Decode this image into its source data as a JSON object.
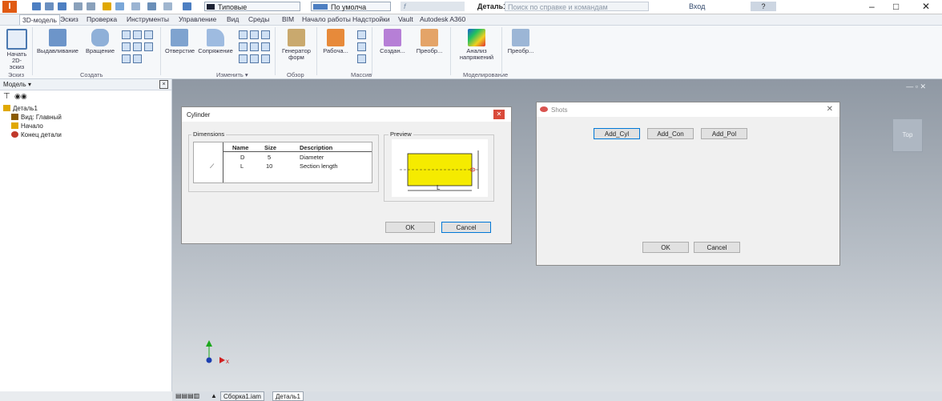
{
  "titlebar": {
    "logo": "I",
    "style_select": "Типовые",
    "material_select": "По умолча",
    "fx_label": "f",
    "doc_title": "Деталь1",
    "help_search_placeholder": "Поиск по справке и командам",
    "login": "Вход",
    "help": "?",
    "minimize": "–",
    "maximize": "□",
    "close": "✕"
  },
  "ribbon_tabs": [
    "3D-модель",
    "Эскиз",
    "Проверка",
    "Инструменты",
    "Управление",
    "Вид",
    "Среды",
    "BIM",
    "Начало работы",
    "Надстройки",
    "Vault",
    "Autodesk A360"
  ],
  "ribbon": {
    "groups": {
      "sketch": "Эскиз",
      "create": "Создать",
      "modify": "Изменить ▾",
      "explore": "Обзор",
      "pattern": "Массив",
      "simulation": "Моделирование"
    },
    "buttons": {
      "start_sketch": "Начать 2D-эскиз",
      "extrude": "Выдавливание",
      "revolve": "Вращение",
      "hole": "Отверстие",
      "fillet": "Сопряжение",
      "shape_generator": "Генератор форм",
      "work_features": "Рабоча...",
      "surface": "Создан...",
      "convert": "Преобр...",
      "stress": "Анализ напряжений",
      "convert2": "Преобр..."
    }
  },
  "browser": {
    "title": "Модель ▾",
    "items": [
      {
        "label": "Деталь1",
        "icon_color": "#e0a800"
      },
      {
        "label": "Вид: Главный",
        "icon_color": "#8a5a00"
      },
      {
        "label": "Начало",
        "icon_color": "#e0a800"
      },
      {
        "label": "Конец детали",
        "icon_color": "#c0392b"
      }
    ]
  },
  "cylinder_dialog": {
    "title": "Cylinder",
    "dimensions_label": "Dimensions",
    "headers": [
      "Name",
      "Size",
      "Description"
    ],
    "rows": [
      {
        "marker": "",
        "name": "D",
        "size": "5",
        "description": "Diameter"
      },
      {
        "marker": "⟋",
        "name": "L",
        "size": "10",
        "description": "Section length"
      }
    ],
    "preview_label": "Preview",
    "preview_L": "L",
    "ok": "OK",
    "cancel": "Cancel",
    "close": "✕",
    "colors": {
      "preview_fill": "#f5eb00",
      "close_bg": "#d94a3a"
    }
  },
  "shots_dialog": {
    "title": "Shots",
    "buttons": [
      "Add_Cyl",
      "Add_Con",
      "Add_Pol"
    ],
    "ok": "OK",
    "cancel": "Cancel",
    "close": "✕"
  },
  "viewcube": {
    "label": "Top"
  },
  "axis": {
    "x": "x"
  },
  "docbar": {
    "tabs": [
      "Сборка1.iam",
      "Деталь1"
    ]
  },
  "colors": {
    "accent": "#0078d7",
    "brand": "#e05a12"
  }
}
